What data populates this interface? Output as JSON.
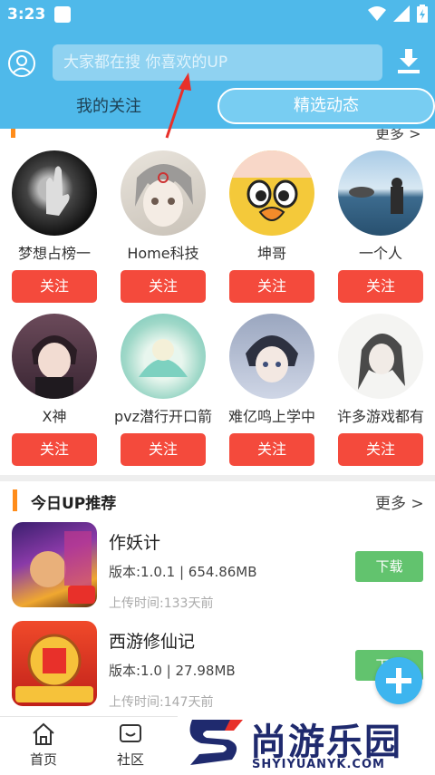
{
  "status_bar": {
    "time": "3:23"
  },
  "header": {
    "search_placeholder": "大家都在搜  你喜欢的UP",
    "tabs": [
      {
        "label": "我的关注"
      },
      {
        "label": "精选动态"
      }
    ]
  },
  "partial_section": {
    "more": "更多 >"
  },
  "ups": [
    {
      "name": "梦想占榜一",
      "follow": "关注"
    },
    {
      "name": "Home科技",
      "follow": "关注"
    },
    {
      "name": "坤哥",
      "follow": "关注"
    },
    {
      "name": "一个人",
      "follow": "关注"
    },
    {
      "name": "X神",
      "follow": "关注"
    },
    {
      "name": "pvz潜行开口箭",
      "follow": "关注"
    },
    {
      "name": "难亿鸣上学中",
      "follow": "关注"
    },
    {
      "name": "许多游戏都有",
      "follow": "关注"
    }
  ],
  "recommend": {
    "title": "今日UP推荐",
    "more": "更多 >",
    "apps": [
      {
        "name": "作妖计",
        "meta": "版本:1.0.1  |  654.86MB",
        "time": "上传时间:133天前",
        "download": "下载"
      },
      {
        "name": "西游修仙记",
        "meta": "版本:1.0  |  27.98MB",
        "time": "上传时间:147天前",
        "download": "下载"
      }
    ]
  },
  "bottom_nav": [
    {
      "label": "首页"
    },
    {
      "label": "社区"
    }
  ],
  "watermark": {
    "text": "尚游乐园",
    "url": "SHYIYUANYK.COM"
  },
  "colors": {
    "header_blue": "#4fb9ea",
    "follow_red": "#f44a3c",
    "download_green": "#62c36e",
    "accent_orange": "#ff8c1a"
  }
}
